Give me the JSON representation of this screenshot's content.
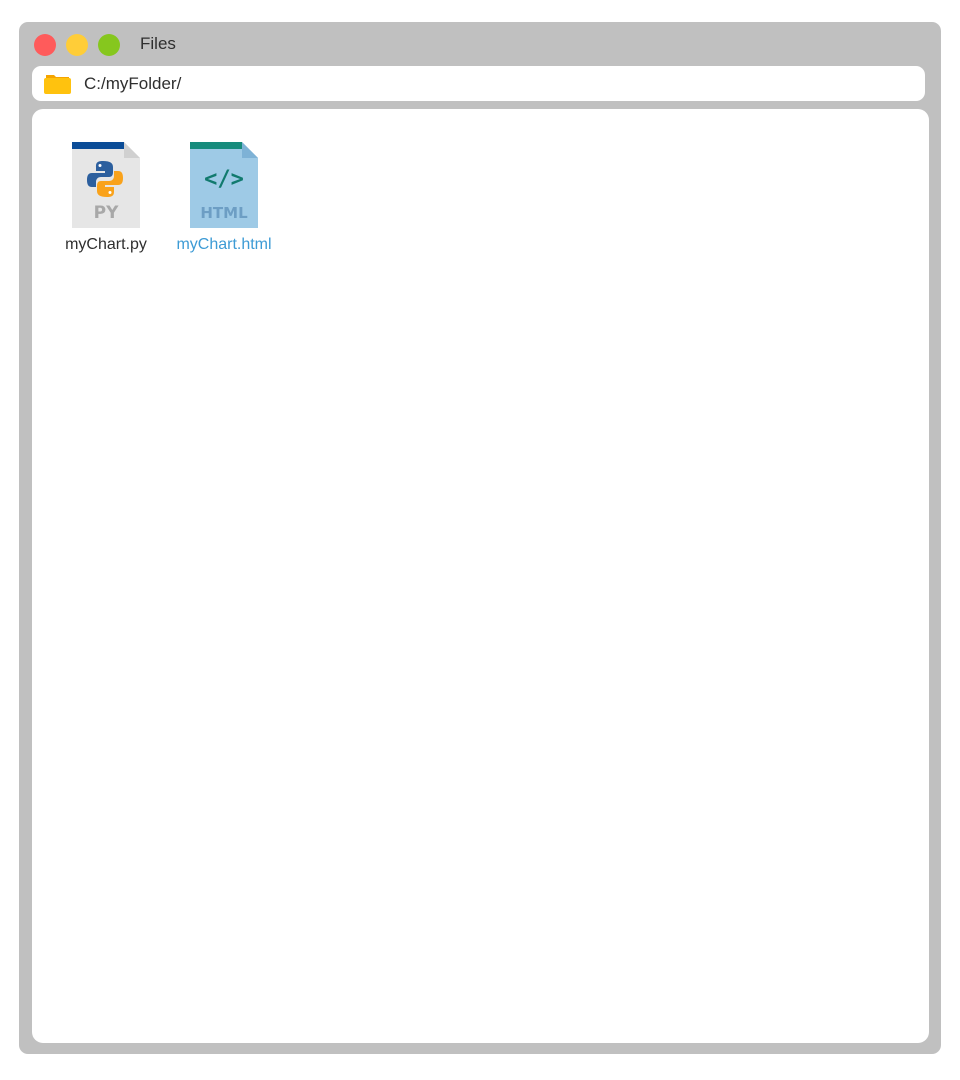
{
  "window": {
    "title": "Files",
    "controls": {
      "close_color": "#ff5b5b",
      "minimize_color": "#ffcd38",
      "maximize_color": "#86c71e"
    }
  },
  "address_bar": {
    "icon": "folder-icon",
    "path": "C:/myFolder/"
  },
  "files": [
    {
      "name": "myChart.py",
      "icon": "python-file-icon",
      "badge": "PY",
      "label_color": "#2f2f2f"
    },
    {
      "name": "myChart.html",
      "icon": "html-file-icon",
      "badge": "HTML",
      "label_color": "#3d9bd5"
    }
  ]
}
